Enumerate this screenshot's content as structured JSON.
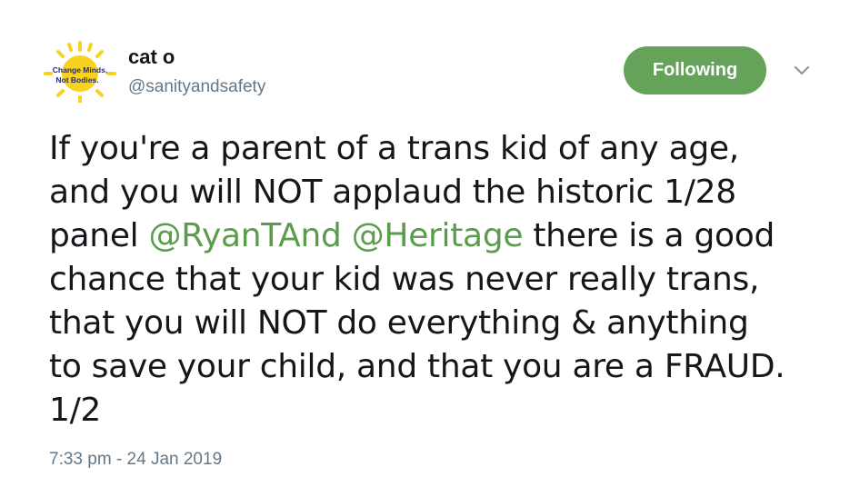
{
  "user": {
    "display_name": "cat o",
    "handle": "@sanityandsafety",
    "avatar_text_1": "Change Minds,",
    "avatar_text_2": "Not Bodies.",
    "avatar_color": "#f7d21f"
  },
  "follow_button": {
    "label": "Following",
    "color": "#66a35a"
  },
  "menu": {
    "icon": "chevron-down-icon"
  },
  "tweet": {
    "line1": "If you're a parent of a trans kid of any age,",
    "line2": "and you will NOT applaud the historic 1/28",
    "line3_pre": "panel ",
    "mention1": "@RyanTAnd",
    "line3_mid": " ",
    "mention2": "@Heritage",
    "line3_post": " there is a good",
    "line4": "chance that your kid was never really trans,",
    "line5": "that you will NOT do everything & anything",
    "line6": "to save your child, and that you are a FRAUD.",
    "line7": "1/2",
    "mention_color": "#5b9b4c"
  },
  "timestamp": "7:33 pm - 24 Jan 2019"
}
